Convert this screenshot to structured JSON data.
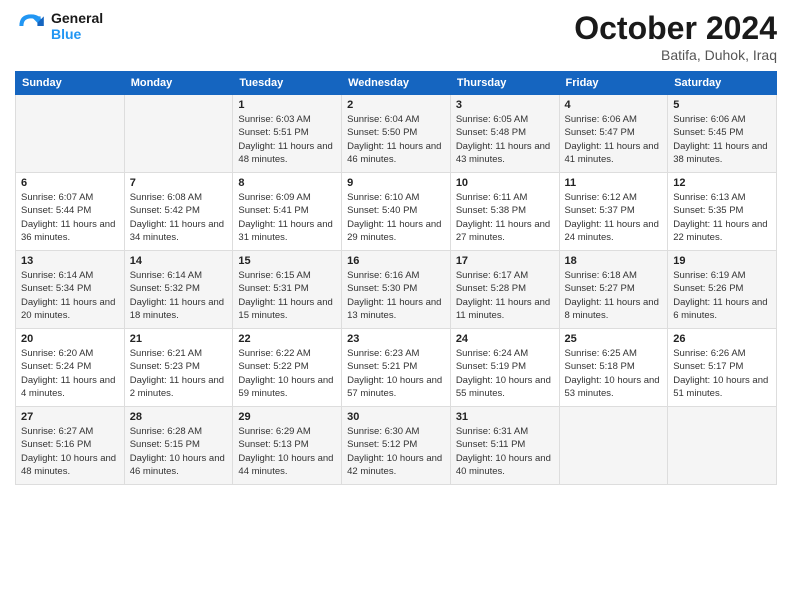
{
  "header": {
    "logo_general": "General",
    "logo_blue": "Blue",
    "month": "October 2024",
    "location": "Batifa, Duhok, Iraq"
  },
  "days_of_week": [
    "Sunday",
    "Monday",
    "Tuesday",
    "Wednesday",
    "Thursday",
    "Friday",
    "Saturday"
  ],
  "weeks": [
    [
      {
        "day": "",
        "sunrise": "",
        "sunset": "",
        "daylight": ""
      },
      {
        "day": "",
        "sunrise": "",
        "sunset": "",
        "daylight": ""
      },
      {
        "day": "1",
        "sunrise": "Sunrise: 6:03 AM",
        "sunset": "Sunset: 5:51 PM",
        "daylight": "Daylight: 11 hours and 48 minutes."
      },
      {
        "day": "2",
        "sunrise": "Sunrise: 6:04 AM",
        "sunset": "Sunset: 5:50 PM",
        "daylight": "Daylight: 11 hours and 46 minutes."
      },
      {
        "day": "3",
        "sunrise": "Sunrise: 6:05 AM",
        "sunset": "Sunset: 5:48 PM",
        "daylight": "Daylight: 11 hours and 43 minutes."
      },
      {
        "day": "4",
        "sunrise": "Sunrise: 6:06 AM",
        "sunset": "Sunset: 5:47 PM",
        "daylight": "Daylight: 11 hours and 41 minutes."
      },
      {
        "day": "5",
        "sunrise": "Sunrise: 6:06 AM",
        "sunset": "Sunset: 5:45 PM",
        "daylight": "Daylight: 11 hours and 38 minutes."
      }
    ],
    [
      {
        "day": "6",
        "sunrise": "Sunrise: 6:07 AM",
        "sunset": "Sunset: 5:44 PM",
        "daylight": "Daylight: 11 hours and 36 minutes."
      },
      {
        "day": "7",
        "sunrise": "Sunrise: 6:08 AM",
        "sunset": "Sunset: 5:42 PM",
        "daylight": "Daylight: 11 hours and 34 minutes."
      },
      {
        "day": "8",
        "sunrise": "Sunrise: 6:09 AM",
        "sunset": "Sunset: 5:41 PM",
        "daylight": "Daylight: 11 hours and 31 minutes."
      },
      {
        "day": "9",
        "sunrise": "Sunrise: 6:10 AM",
        "sunset": "Sunset: 5:40 PM",
        "daylight": "Daylight: 11 hours and 29 minutes."
      },
      {
        "day": "10",
        "sunrise": "Sunrise: 6:11 AM",
        "sunset": "Sunset: 5:38 PM",
        "daylight": "Daylight: 11 hours and 27 minutes."
      },
      {
        "day": "11",
        "sunrise": "Sunrise: 6:12 AM",
        "sunset": "Sunset: 5:37 PM",
        "daylight": "Daylight: 11 hours and 24 minutes."
      },
      {
        "day": "12",
        "sunrise": "Sunrise: 6:13 AM",
        "sunset": "Sunset: 5:35 PM",
        "daylight": "Daylight: 11 hours and 22 minutes."
      }
    ],
    [
      {
        "day": "13",
        "sunrise": "Sunrise: 6:14 AM",
        "sunset": "Sunset: 5:34 PM",
        "daylight": "Daylight: 11 hours and 20 minutes."
      },
      {
        "day": "14",
        "sunrise": "Sunrise: 6:14 AM",
        "sunset": "Sunset: 5:32 PM",
        "daylight": "Daylight: 11 hours and 18 minutes."
      },
      {
        "day": "15",
        "sunrise": "Sunrise: 6:15 AM",
        "sunset": "Sunset: 5:31 PM",
        "daylight": "Daylight: 11 hours and 15 minutes."
      },
      {
        "day": "16",
        "sunrise": "Sunrise: 6:16 AM",
        "sunset": "Sunset: 5:30 PM",
        "daylight": "Daylight: 11 hours and 13 minutes."
      },
      {
        "day": "17",
        "sunrise": "Sunrise: 6:17 AM",
        "sunset": "Sunset: 5:28 PM",
        "daylight": "Daylight: 11 hours and 11 minutes."
      },
      {
        "day": "18",
        "sunrise": "Sunrise: 6:18 AM",
        "sunset": "Sunset: 5:27 PM",
        "daylight": "Daylight: 11 hours and 8 minutes."
      },
      {
        "day": "19",
        "sunrise": "Sunrise: 6:19 AM",
        "sunset": "Sunset: 5:26 PM",
        "daylight": "Daylight: 11 hours and 6 minutes."
      }
    ],
    [
      {
        "day": "20",
        "sunrise": "Sunrise: 6:20 AM",
        "sunset": "Sunset: 5:24 PM",
        "daylight": "Daylight: 11 hours and 4 minutes."
      },
      {
        "day": "21",
        "sunrise": "Sunrise: 6:21 AM",
        "sunset": "Sunset: 5:23 PM",
        "daylight": "Daylight: 11 hours and 2 minutes."
      },
      {
        "day": "22",
        "sunrise": "Sunrise: 6:22 AM",
        "sunset": "Sunset: 5:22 PM",
        "daylight": "Daylight: 10 hours and 59 minutes."
      },
      {
        "day": "23",
        "sunrise": "Sunrise: 6:23 AM",
        "sunset": "Sunset: 5:21 PM",
        "daylight": "Daylight: 10 hours and 57 minutes."
      },
      {
        "day": "24",
        "sunrise": "Sunrise: 6:24 AM",
        "sunset": "Sunset: 5:19 PM",
        "daylight": "Daylight: 10 hours and 55 minutes."
      },
      {
        "day": "25",
        "sunrise": "Sunrise: 6:25 AM",
        "sunset": "Sunset: 5:18 PM",
        "daylight": "Daylight: 10 hours and 53 minutes."
      },
      {
        "day": "26",
        "sunrise": "Sunrise: 6:26 AM",
        "sunset": "Sunset: 5:17 PM",
        "daylight": "Daylight: 10 hours and 51 minutes."
      }
    ],
    [
      {
        "day": "27",
        "sunrise": "Sunrise: 6:27 AM",
        "sunset": "Sunset: 5:16 PM",
        "daylight": "Daylight: 10 hours and 48 minutes."
      },
      {
        "day": "28",
        "sunrise": "Sunrise: 6:28 AM",
        "sunset": "Sunset: 5:15 PM",
        "daylight": "Daylight: 10 hours and 46 minutes."
      },
      {
        "day": "29",
        "sunrise": "Sunrise: 6:29 AM",
        "sunset": "Sunset: 5:13 PM",
        "daylight": "Daylight: 10 hours and 44 minutes."
      },
      {
        "day": "30",
        "sunrise": "Sunrise: 6:30 AM",
        "sunset": "Sunset: 5:12 PM",
        "daylight": "Daylight: 10 hours and 42 minutes."
      },
      {
        "day": "31",
        "sunrise": "Sunrise: 6:31 AM",
        "sunset": "Sunset: 5:11 PM",
        "daylight": "Daylight: 10 hours and 40 minutes."
      },
      {
        "day": "",
        "sunrise": "",
        "sunset": "",
        "daylight": ""
      },
      {
        "day": "",
        "sunrise": "",
        "sunset": "",
        "daylight": ""
      }
    ]
  ]
}
